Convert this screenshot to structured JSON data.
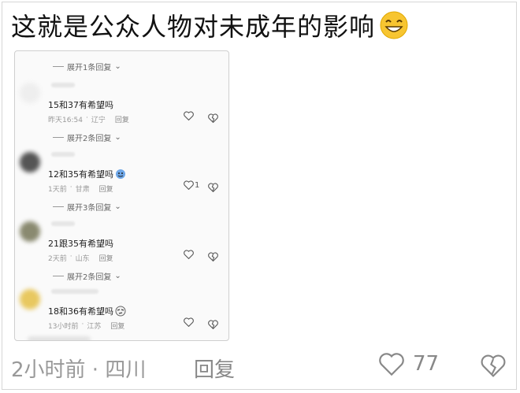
{
  "post": {
    "title": "这就是公众人物对未成年的影响",
    "title_emoji": "grinning-face-emoji"
  },
  "screenshot": {
    "expand_labels": [
      "展开1条回复",
      "展开2条回复",
      "展开3条回复",
      "展开2条回复"
    ],
    "comments": [
      {
        "text": "15和37有希望吗",
        "time": "昨天16:54",
        "location": "辽宁",
        "reply": "回复",
        "likes": "",
        "emoji": ""
      },
      {
        "text": "12和35有希望吗",
        "time": "1天前",
        "location": "甘肃",
        "reply": "回复",
        "likes": "1",
        "emoji": "shy-face-emoji"
      },
      {
        "text": "21跟35有希望吗",
        "time": "2天前",
        "location": "山东",
        "reply": "回复",
        "likes": "",
        "emoji": ""
      },
      {
        "text": "18和36有希望吗",
        "time": "13小时前",
        "location": "江苏",
        "reply": "回复",
        "likes": "",
        "emoji": "smirk-face-emoji"
      }
    ]
  },
  "footer": {
    "time_location": "2小时前 · 四川",
    "reply_label": "回复",
    "like_count": "77"
  },
  "colors": {
    "muted": "#999999",
    "text": "#111111",
    "emoji_yellow": "#f7c531"
  }
}
